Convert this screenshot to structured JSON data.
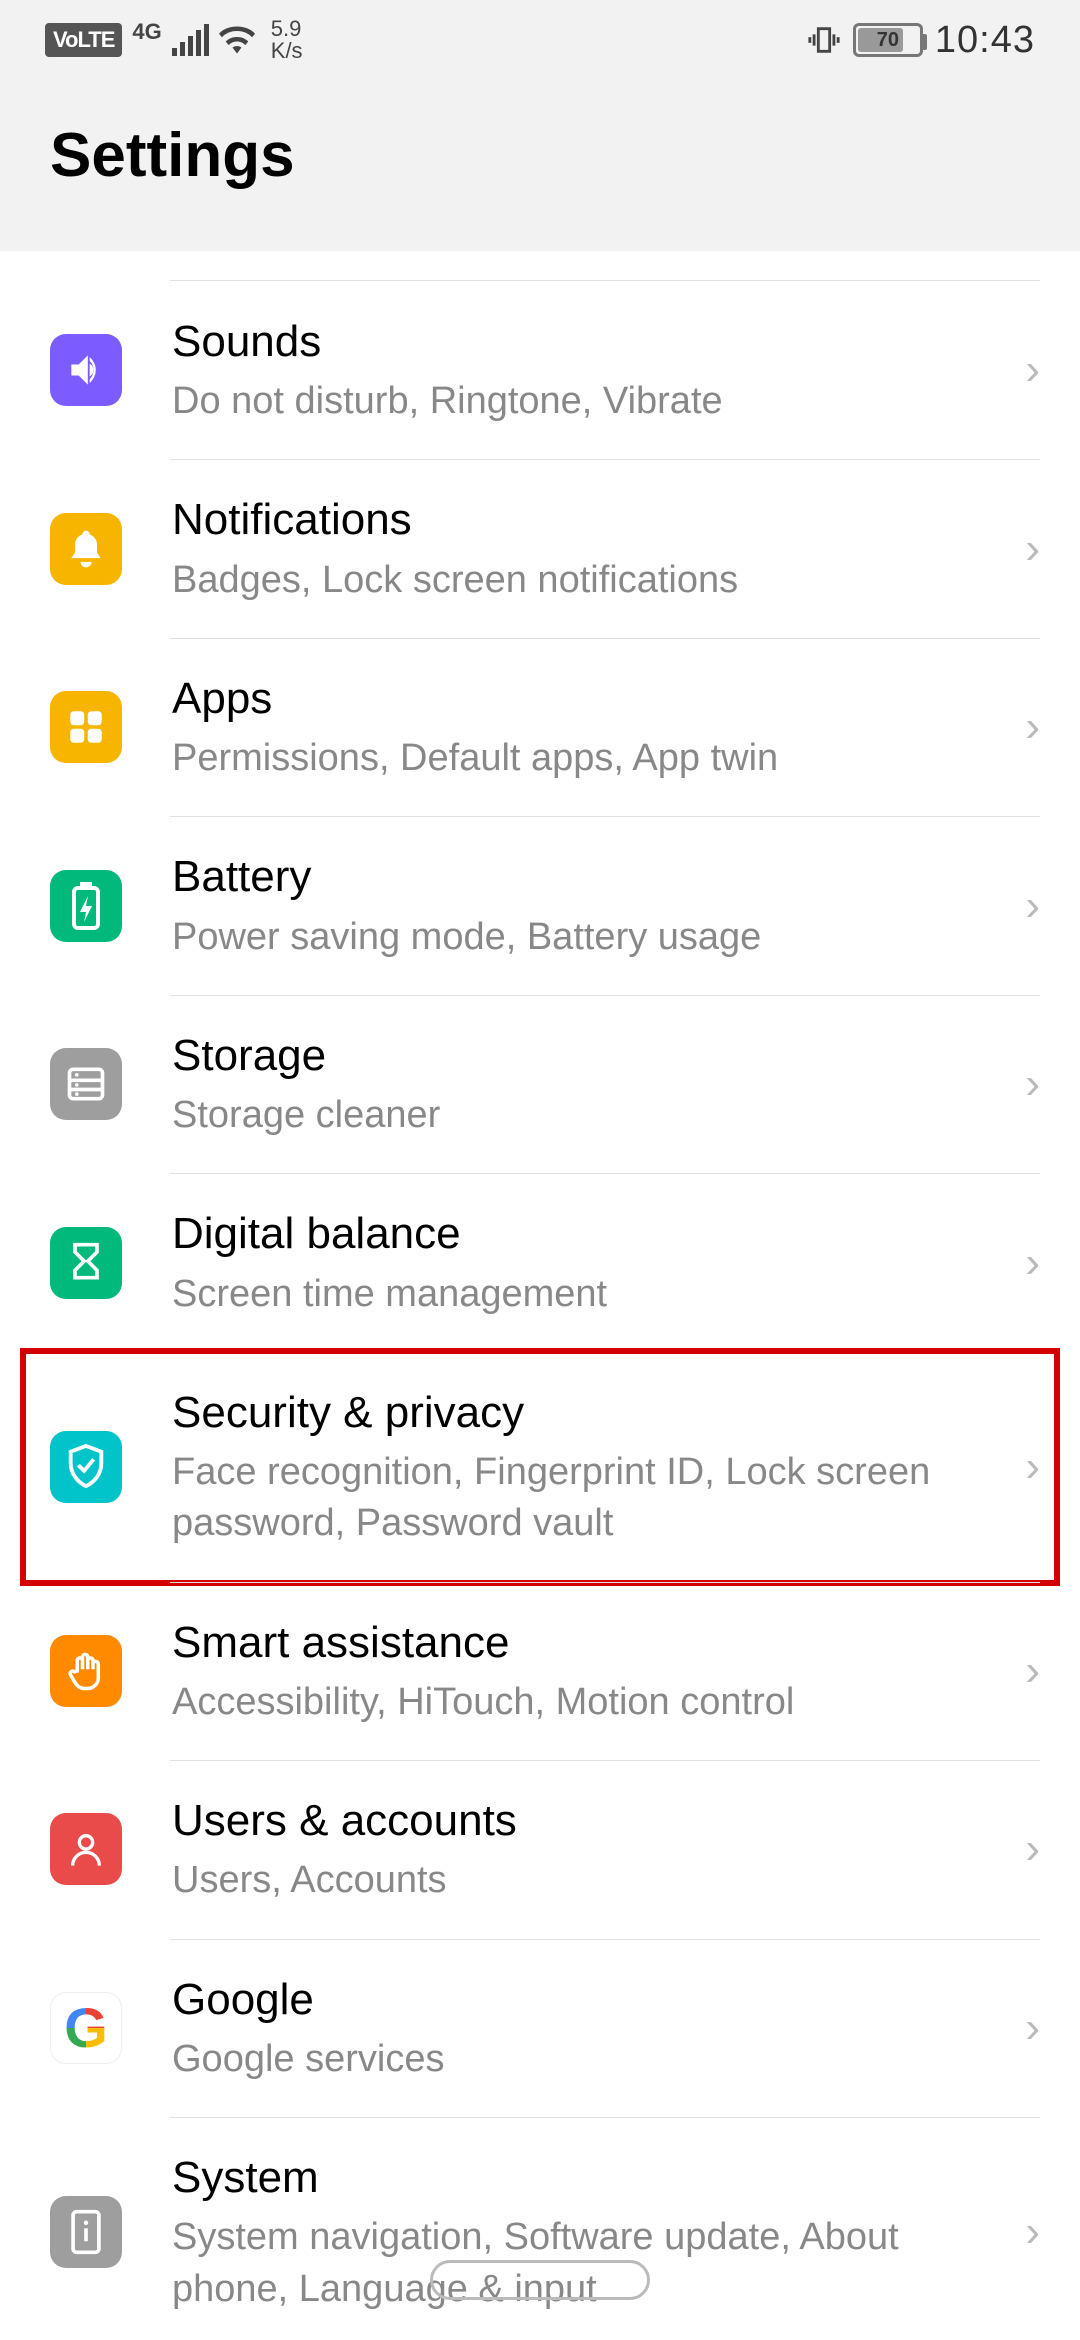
{
  "statusbar": {
    "volte": "VoLTE",
    "network": "4G",
    "speed_top": "5.9",
    "speed_bot": "K/s",
    "battery": "70",
    "time": "10:43"
  },
  "header": {
    "title": "Settings"
  },
  "items": [
    {
      "title": "Sounds",
      "sub": "Do not disturb, Ringtone, Vibrate",
      "icon": "speaker-icon",
      "color": "c-purple"
    },
    {
      "title": "Notifications",
      "sub": "Badges, Lock screen notifications",
      "icon": "bell-icon",
      "color": "c-yellow"
    },
    {
      "title": "Apps",
      "sub": "Permissions, Default apps, App twin",
      "icon": "grid-icon",
      "color": "c-yellow"
    },
    {
      "title": "Battery",
      "sub": "Power saving mode, Battery usage",
      "icon": "battery-icon",
      "color": "c-green"
    },
    {
      "title": "Storage",
      "sub": "Storage cleaner",
      "icon": "server-icon",
      "color": "c-gray"
    },
    {
      "title": "Digital balance",
      "sub": "Screen time management",
      "icon": "hourglass-icon",
      "color": "c-green"
    },
    {
      "title": "Security & privacy",
      "sub": "Face recognition, Fingerprint ID, Lock screen password, Password vault",
      "icon": "shield-icon",
      "color": "c-teal",
      "highlighted": true
    },
    {
      "title": "Smart assistance",
      "sub": "Accessibility, HiTouch, Motion control",
      "icon": "hand-icon",
      "color": "c-orange"
    },
    {
      "title": "Users & accounts",
      "sub": "Users, Accounts",
      "icon": "user-icon",
      "color": "c-red"
    },
    {
      "title": "Google",
      "sub": "Google services",
      "icon": "google-icon",
      "color": "google"
    },
    {
      "title": "System",
      "sub": "System navigation, Software update, About phone, Language & input",
      "icon": "phone-info-icon",
      "color": "c-gray"
    }
  ]
}
